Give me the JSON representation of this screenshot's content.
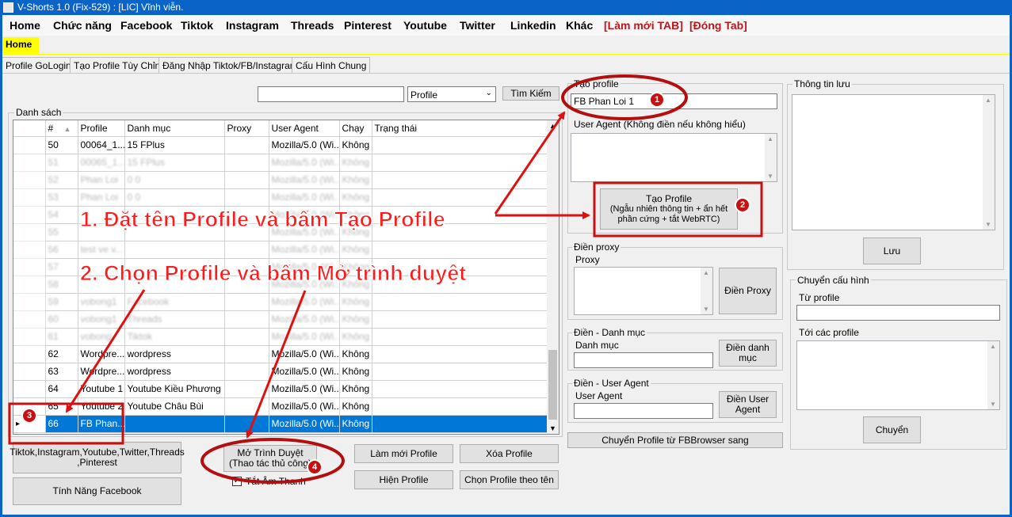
{
  "window_title": "V-Shorts 1.0 (Fix-529) : [LIC] Vĩnh viễn.",
  "menu": [
    "Home",
    "Chức năng",
    "Facebook",
    "Tiktok",
    "Instagram",
    "Threads",
    "Pinterest",
    "Youtube",
    "Twitter",
    "Linkedin",
    "Khác"
  ],
  "menu_red": [
    "[Làm mới TAB]",
    "[Đóng Tab]"
  ],
  "home_tab": "Home",
  "subtabs": [
    "Profile GoLogin",
    "Tạo Profile Tùy Chỉnh",
    "Đăng Nhập Tiktok/FB/Instagram",
    "Cấu Hình Chung"
  ],
  "search": {
    "value": "",
    "select": "Profile",
    "button": "Tìm Kiếm"
  },
  "list_label": "Danh sách",
  "columns": [
    "#",
    "Profile",
    "Danh mục",
    "Proxy",
    "User Agent",
    "Chạy",
    "Trạng thái"
  ],
  "rows": [
    {
      "n": "50",
      "profile": "00064_1...",
      "cat": "15 FPlus",
      "proxy": "",
      "ua": "Mozilla/5.0 (Wi...",
      "run": "Không",
      "status": ""
    },
    {
      "n": "51",
      "profile": "00065_1...",
      "cat": "15 FPlus",
      "proxy": "",
      "ua": "Mozilla/5.0 (Wi...",
      "run": "Không",
      "status": ""
    },
    {
      "n": "52",
      "profile": "Phan Loi",
      "cat": "0 0",
      "proxy": "",
      "ua": "Mozilla/5.0 (Wi...",
      "run": "Không",
      "status": ""
    },
    {
      "n": "53",
      "profile": "Phan Loi",
      "cat": "0 0",
      "proxy": "",
      "ua": "Mozilla/5.0 (Wi...",
      "run": "Không",
      "status": ""
    },
    {
      "n": "54",
      "profile": "",
      "cat": "",
      "proxy": "",
      "ua": "Mozilla/5.0 (Wi...",
      "run": "Không",
      "status": ""
    },
    {
      "n": "55",
      "profile": "",
      "cat": "",
      "proxy": "",
      "ua": "Mozilla/5.0 (Wi...",
      "run": "Không",
      "status": ""
    },
    {
      "n": "56",
      "profile": "test ve v...",
      "cat": "",
      "proxy": "",
      "ua": "Mozilla/5.0 (Wi...",
      "run": "Không",
      "status": ""
    },
    {
      "n": "57",
      "profile": "",
      "cat": "",
      "proxy": "",
      "ua": "Mozilla/5.0 (Wi...",
      "run": "Không",
      "status": ""
    },
    {
      "n": "58",
      "profile": "",
      "cat": "",
      "proxy": "",
      "ua": "Mozilla/5.0 (Wi...",
      "run": "Không",
      "status": ""
    },
    {
      "n": "59",
      "profile": "vobong1",
      "cat": "Facebook",
      "proxy": "",
      "ua": "Mozilla/5.0 (Wi...",
      "run": "Không",
      "status": ""
    },
    {
      "n": "60",
      "profile": "vobong1",
      "cat": "Threads",
      "proxy": "",
      "ua": "Mozilla/5.0 (Wi...",
      "run": "Không",
      "status": ""
    },
    {
      "n": "61",
      "profile": "vobong",
      "cat": "Tiktok",
      "proxy": "",
      "ua": "Mozilla/5.0 (Wi...",
      "run": "Không",
      "status": ""
    },
    {
      "n": "62",
      "profile": "Wordpre...",
      "cat": "wordpress",
      "proxy": "",
      "ua": "Mozilla/5.0 (Wi...",
      "run": "Không",
      "status": ""
    },
    {
      "n": "63",
      "profile": "Wordpre...",
      "cat": "wordpress",
      "proxy": "",
      "ua": "Mozilla/5.0 (Wi...",
      "run": "Không",
      "status": ""
    },
    {
      "n": "64",
      "profile": "Youtube 1",
      "cat": "Youtube Kiều Phương",
      "proxy": "",
      "ua": "Mozilla/5.0 (Wi...",
      "run": "Không",
      "status": ""
    },
    {
      "n": "65",
      "profile": "Youtube 2",
      "cat": "Youtube Châu Bùi",
      "proxy": "",
      "ua": "Mozilla/5.0 (Wi...",
      "run": "Không",
      "status": ""
    },
    {
      "n": "66",
      "profile": "FB Phan...",
      "cat": "",
      "proxy": "",
      "ua": "Mozilla/5.0 (Wi...",
      "run": "Không",
      "status": ""
    }
  ],
  "left_buttons": {
    "social": "Tiktok,Instagram,Youtube,Twitter,Threads ,Pinterest",
    "facebook": "Tính Năng Facebook"
  },
  "open_browser": {
    "line1": "Mở Trình Duyệt",
    "line2": "(Thao tác thủ công)"
  },
  "mute_label": "Tắt Âm Thanh",
  "buttons": {
    "refresh": "Làm mới Profile",
    "delete": "Xóa Profile",
    "show": "Hiện Profile",
    "select_by_name": "Chọn Profile theo tên"
  },
  "create": {
    "label": "Tạo profile",
    "name": "FB Phan Loi 1",
    "ua_label": "User Agent (Không điền nếu không hiểu)",
    "btn_title": "Tạo Profile",
    "btn_sub1": "(Ngẫu nhiên thông tin + ẩn hết",
    "btn_sub2": "phần cứng + tắt WebRTC)"
  },
  "proxy_group": {
    "title": "Điền proxy",
    "label": "Proxy",
    "button": "Điền Proxy"
  },
  "category_group": {
    "title": "Điền - Danh mục",
    "label": "Danh mục",
    "button1": "Điền danh",
    "button2": "mục"
  },
  "ua_group": {
    "title": "Điền - User Agent",
    "label": "User Agent",
    "button1": "Điền User",
    "button2": "Agent"
  },
  "transfer_fb": "Chuyển Profile từ FBBrowser sang",
  "info": {
    "title": "Thông tin lưu",
    "save": "Lưu"
  },
  "config": {
    "title": "Chuyển cấu hình",
    "from": "Từ profile",
    "to": "Tới các profile",
    "button": "Chuyển"
  },
  "annotations": {
    "step1": "1. Đặt tên Profile và bấm Tạo Profile",
    "step2": "2. Chọn Profile và bấm Mở trình duyệt",
    "badges": [
      "1",
      "2",
      "3",
      "4"
    ]
  },
  "colors": {
    "accent": "#0078d7",
    "annotation": "#ff1a1a",
    "circle": "#c81010",
    "highlight": "#ffff00"
  }
}
